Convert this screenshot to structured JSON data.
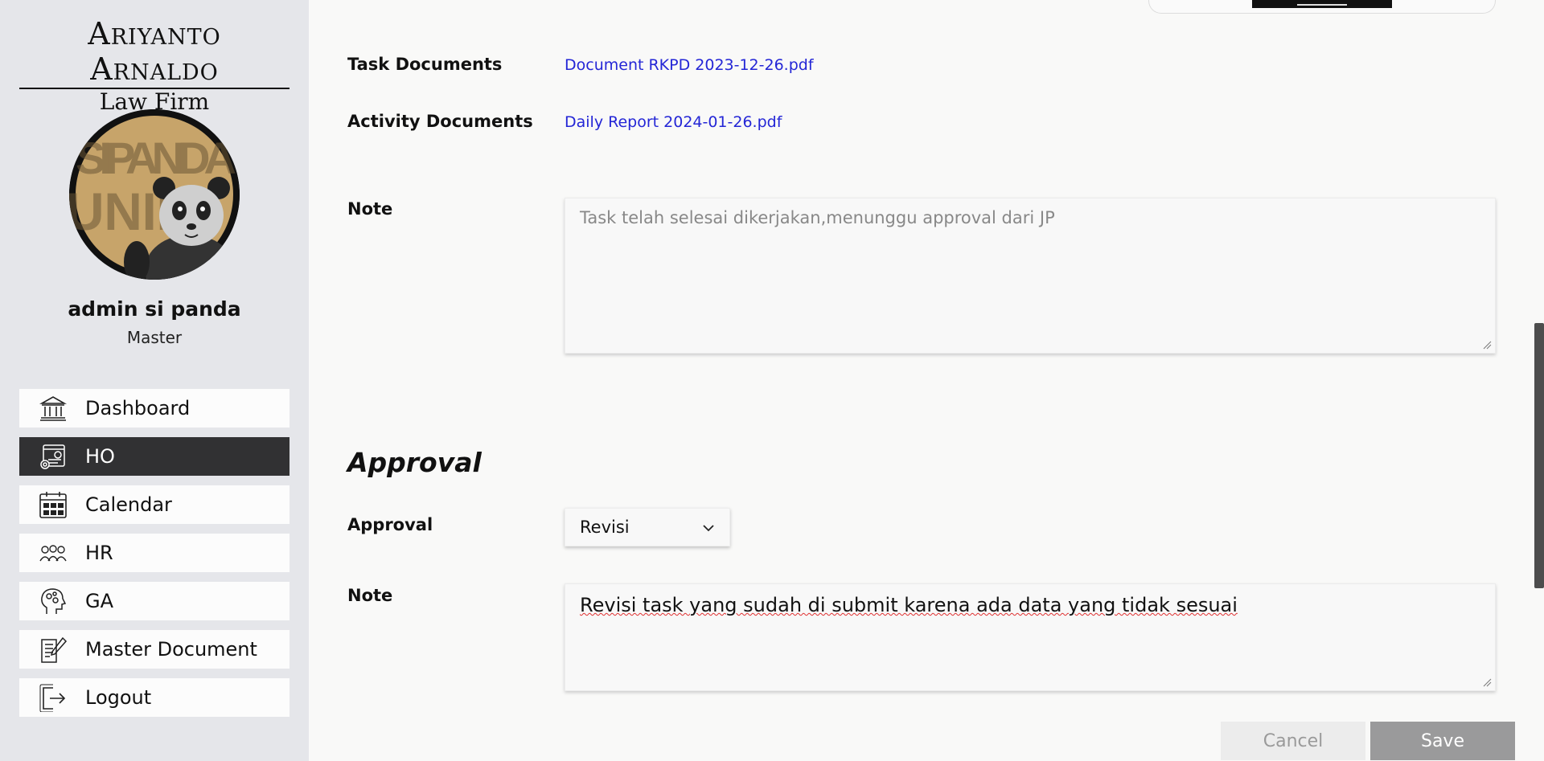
{
  "brand": {
    "line1": "Ariyanto Arnaldo",
    "line2": "Law Firm"
  },
  "user": {
    "name": "admin si panda",
    "role": "Master",
    "avatar_text": "SIPANDA UNIK"
  },
  "menu": [
    {
      "label": "Dashboard",
      "icon": "bank-building-icon",
      "active": false
    },
    {
      "label": "HO",
      "icon": "office-settings-icon",
      "active": true
    },
    {
      "label": "Calendar",
      "icon": "calendar-icon",
      "active": false
    },
    {
      "label": "HR",
      "icon": "people-group-icon",
      "active": false
    },
    {
      "label": "GA",
      "icon": "head-gears-icon",
      "active": false
    },
    {
      "label": "Master Document",
      "icon": "document-edit-icon",
      "active": false
    },
    {
      "label": "Logout",
      "icon": "logout-icon",
      "active": false
    }
  ],
  "documents": {
    "task_label": "Task Documents",
    "task_file": "Document RKPD 2023-12-26.pdf",
    "activity_label": "Activity Documents",
    "activity_file": "Daily Report 2024-01-26.pdf"
  },
  "note": {
    "label": "Note",
    "value": "Task telah selesai dikerjakan,menunggu approval dari JP"
  },
  "approval": {
    "section_title": "Approval",
    "label": "Approval",
    "selected": "Revisi",
    "note_label": "Note",
    "note_value": "Revisi task yang sudah di submit karena ada data yang tidak sesuai"
  },
  "actions": {
    "cancel": "Cancel",
    "save": "Save"
  }
}
